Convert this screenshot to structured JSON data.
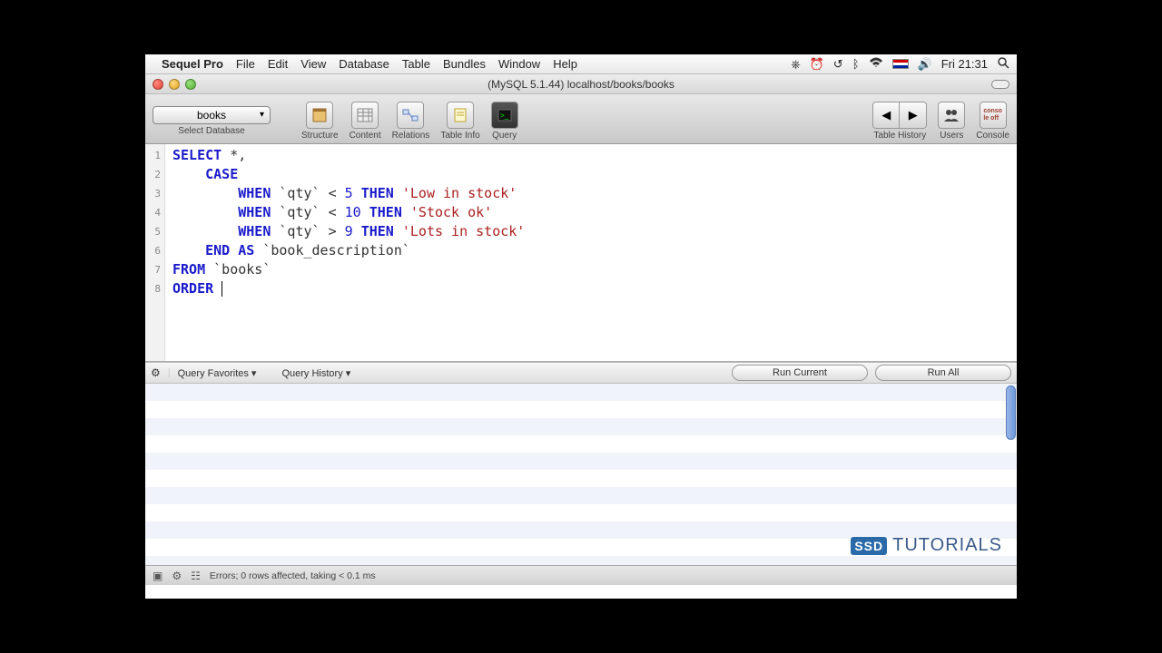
{
  "menubar": {
    "app": "Sequel Pro",
    "items": [
      "File",
      "Edit",
      "View",
      "Database",
      "Table",
      "Bundles",
      "Window",
      "Help"
    ],
    "clock": "Fri 21:31"
  },
  "window": {
    "title": "(MySQL 5.1.44) localhost/books/books"
  },
  "toolbar": {
    "select_db": {
      "value": "books",
      "label": "Select Database"
    },
    "buttons": {
      "structure": "Structure",
      "content": "Content",
      "relations": "Relations",
      "tableinfo": "Table Info",
      "query": "Query",
      "tablehistory": "Table History",
      "users": "Users",
      "console": "Console"
    }
  },
  "sql": {
    "lines": [
      "1",
      "2",
      "3",
      "4",
      "5",
      "6",
      "7",
      "8"
    ],
    "tokens": [
      [
        {
          "t": "kw",
          "v": "SELECT"
        },
        {
          "t": "punc",
          "v": " *,"
        }
      ],
      [
        {
          "t": "punc",
          "v": "    "
        },
        {
          "t": "kw",
          "v": "CASE"
        }
      ],
      [
        {
          "t": "punc",
          "v": "        "
        },
        {
          "t": "kw",
          "v": "WHEN"
        },
        {
          "t": "punc",
          "v": " `qty` < "
        },
        {
          "t": "num",
          "v": "5"
        },
        {
          "t": "punc",
          "v": " "
        },
        {
          "t": "kw",
          "v": "THEN"
        },
        {
          "t": "punc",
          "v": " "
        },
        {
          "t": "str",
          "v": "'Low in stock'"
        }
      ],
      [
        {
          "t": "punc",
          "v": "        "
        },
        {
          "t": "kw",
          "v": "WHEN"
        },
        {
          "t": "punc",
          "v": " `qty` < "
        },
        {
          "t": "num",
          "v": "10"
        },
        {
          "t": "punc",
          "v": " "
        },
        {
          "t": "kw",
          "v": "THEN"
        },
        {
          "t": "punc",
          "v": " "
        },
        {
          "t": "str",
          "v": "'Stock ok'"
        }
      ],
      [
        {
          "t": "punc",
          "v": "        "
        },
        {
          "t": "kw",
          "v": "WHEN"
        },
        {
          "t": "punc",
          "v": " `qty` > "
        },
        {
          "t": "num",
          "v": "9"
        },
        {
          "t": "punc",
          "v": " "
        },
        {
          "t": "kw",
          "v": "THEN"
        },
        {
          "t": "punc",
          "v": " "
        },
        {
          "t": "str",
          "v": "'Lots in stock'"
        }
      ],
      [
        {
          "t": "punc",
          "v": "    "
        },
        {
          "t": "kw",
          "v": "END AS"
        },
        {
          "t": "punc",
          "v": " `book_description`"
        }
      ],
      [
        {
          "t": "kw",
          "v": "FROM"
        },
        {
          "t": "punc",
          "v": " `books`"
        }
      ],
      [
        {
          "t": "kw",
          "v": "ORDER"
        },
        {
          "t": "punc",
          "v": " "
        }
      ]
    ]
  },
  "querybar": {
    "favorites": "Query Favorites",
    "history": "Query History",
    "run_current": "Run Current",
    "run_all": "Run All"
  },
  "status": {
    "text": "Errors; 0 rows affected, taking < 0.1 ms"
  },
  "watermark": {
    "badge": "SSD",
    "text": "TUTORIALS"
  }
}
